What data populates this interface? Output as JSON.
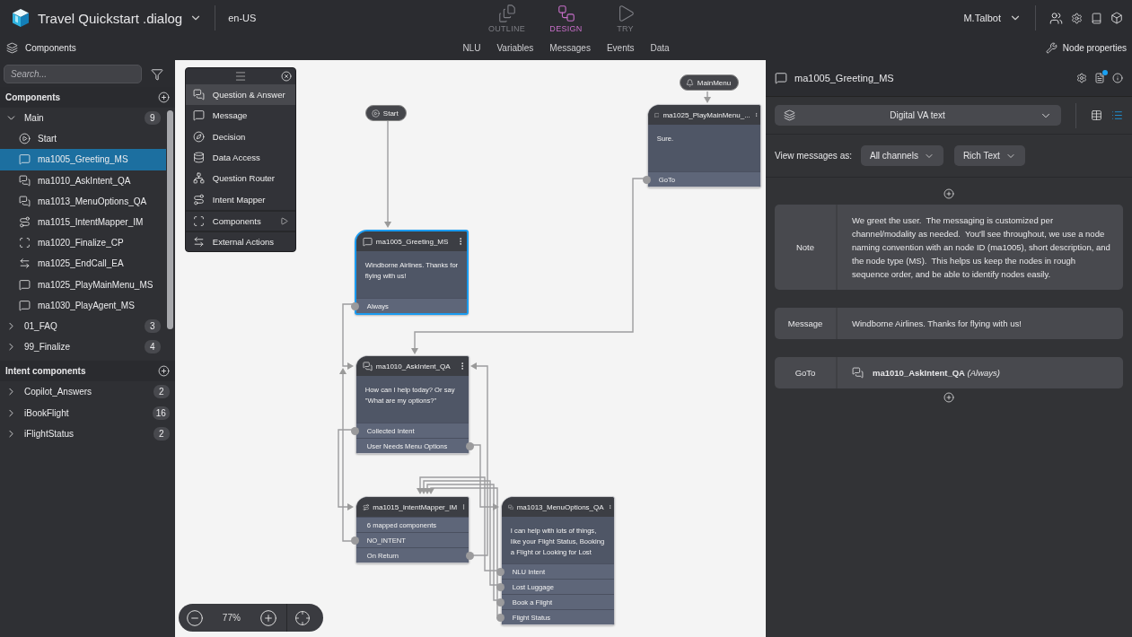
{
  "app": {
    "title": "Travel Quickstart .dialog",
    "locale": "en-US",
    "user": "M.Talbot",
    "modes": [
      {
        "label": "OUTLINE",
        "kind": "outline",
        "selected": false,
        "disabled": true
      },
      {
        "label": "DESIGN",
        "kind": "design",
        "selected": true,
        "disabled": false
      },
      {
        "label": "TRY",
        "kind": "try",
        "selected": false,
        "disabled": true
      }
    ]
  },
  "subbar": {
    "panel_title": "Components",
    "tabs": [
      {
        "label": "NLU"
      },
      {
        "label": "Variables"
      },
      {
        "label": "Messages"
      },
      {
        "label": "Events"
      },
      {
        "label": "Data"
      }
    ],
    "right_title": "Node properties"
  },
  "sidebar": {
    "search_placeholder": "Search...",
    "sections": [
      {
        "title": "Components",
        "groups": [
          {
            "label": "Main",
            "count": "9",
            "expanded": true,
            "children": [
              {
                "label": "Start",
                "kind": "start",
                "selected": false
              },
              {
                "label": "ma1005_Greeting_MS",
                "kind": "message",
                "selected": true
              },
              {
                "label": "ma1010_AskIntent_QA",
                "kind": "qa",
                "selected": false
              },
              {
                "label": "ma1013_MenuOptions_QA",
                "kind": "qa",
                "selected": false
              },
              {
                "label": "ma1015_IntentMapper_IM",
                "kind": "intent_mapper",
                "selected": false
              },
              {
                "label": "ma1020_Finalize_CP",
                "kind": "component",
                "selected": false
              },
              {
                "label": "ma1025_EndCall_EA",
                "kind": "external",
                "selected": false
              },
              {
                "label": "ma1025_PlayMainMenu_MS",
                "kind": "message",
                "selected": false
              },
              {
                "label": "ma1030_PlayAgent_MS",
                "kind": "message",
                "selected": false
              }
            ]
          },
          {
            "label": "01_FAQ",
            "count": "3",
            "expanded": false
          },
          {
            "label": "99_Finalize",
            "count": "4",
            "expanded": false
          }
        ]
      },
      {
        "title": "Intent components",
        "groups": [
          {
            "label": "Copilot_Answers",
            "count": "2",
            "expanded": false
          },
          {
            "label": "iBookFlight",
            "count": "16",
            "expanded": false
          },
          {
            "label": "iFlightStatus",
            "count": "2",
            "expanded": false
          }
        ]
      }
    ]
  },
  "palette": {
    "items": [
      {
        "label": "Question & Answer",
        "kind": "qa",
        "selected": true
      },
      {
        "label": "Message",
        "kind": "message",
        "selected": false
      },
      {
        "label": "Decision",
        "kind": "decision",
        "selected": false
      },
      {
        "label": "Data Access",
        "kind": "data",
        "selected": false
      },
      {
        "label": "Question Router",
        "kind": "router",
        "selected": false
      },
      {
        "label": "Intent Mapper",
        "kind": "intent_mapper",
        "selected": false
      },
      {
        "label": "Components",
        "kind": "component",
        "selected": false
      },
      {
        "label": "External Actions",
        "kind": "external",
        "selected": false
      }
    ]
  },
  "canvas": {
    "zoom": "77%",
    "nodes": [
      {
        "kind": "start",
        "title": "Start"
      },
      {
        "kind": "event",
        "title": "MainMenu"
      },
      {
        "kind": "message",
        "title": "ma1005_Greeting_MS",
        "selected": true,
        "body": "Windborne Airlines. Thanks for flying with us!",
        "rows": [
          {
            "label": "Always",
            "port_left": true,
            "port_right": false
          }
        ]
      },
      {
        "kind": "message",
        "title": "ma1025_PlayMainMenu_...",
        "selected": false,
        "body": "Sure.",
        "rows": [
          {
            "label": "GoTo",
            "port_left": true,
            "port_right": false
          }
        ]
      },
      {
        "kind": "qa",
        "title": "ma1010_AskIntent_QA",
        "selected": false,
        "body": "How can I help today? Or say \"What are my options?\"",
        "rows": [
          {
            "label": "Collected Intent",
            "port_left": true,
            "port_right": false
          },
          {
            "label": "User Needs Menu Options",
            "port_left": false,
            "port_right": true
          }
        ]
      },
      {
        "kind": "intent_mapper",
        "title": "ma1015_IntentMapper_IM",
        "selected": false,
        "rows": [
          {
            "label": "6 mapped components",
            "port_left": false,
            "port_right": false
          },
          {
            "label": "NO_INTENT",
            "port_left": true,
            "port_right": false
          },
          {
            "label": "On Return",
            "port_left": false,
            "port_right": true
          }
        ]
      },
      {
        "kind": "qa",
        "title": "ma1013_MenuOptions_QA",
        "selected": false,
        "body": "I can help with lots of things, like your Flight Status, Booking a Flight or Looking for Lost",
        "rows": [
          {
            "label": "NLU Intent",
            "port_left": true,
            "port_right": false
          },
          {
            "label": "Lost Luggage",
            "port_left": true,
            "port_right": false
          },
          {
            "label": "Book a Flight",
            "port_left": true,
            "port_right": false
          },
          {
            "label": "Flight Status",
            "port_left": true,
            "port_right": false
          }
        ]
      }
    ]
  },
  "properties": {
    "title": "ma1005_Greeting_MS",
    "channel": "Digital VA text",
    "view_label": "View messages as:",
    "view_options": [
      "All channels",
      "Rich Text"
    ],
    "layouts": [
      {
        "kind": "table",
        "selected": false
      },
      {
        "kind": "list",
        "selected": true
      }
    ],
    "fields": [
      {
        "label": "Note",
        "kind": "text",
        "value": "We greet the user.  The messaging is customized per channel/modality as needed.  You'll see throughout, we use a node naming convention with an node ID (ma1005), short description, and the node type (MS).  This helps us keep the nodes in rough sequence order, and be able to identify nodes easily."
      },
      {
        "label": "Message",
        "kind": "text",
        "value": "Windborne Airlines. Thanks for flying with us!"
      },
      {
        "label": "GoTo",
        "kind": "goto",
        "value": "**ma1010_AskIntent_QA** *(Always)*"
      }
    ]
  }
}
